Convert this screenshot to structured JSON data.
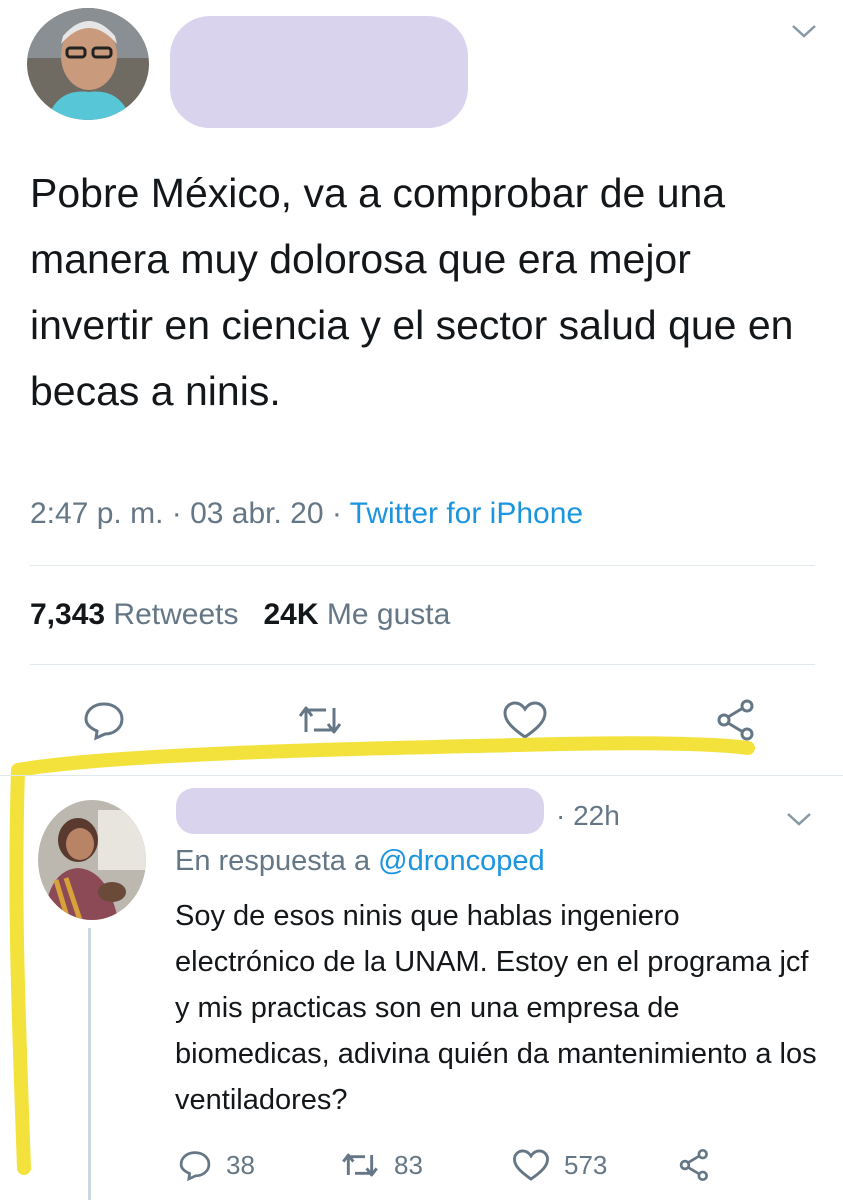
{
  "tweet": {
    "text": "Pobre México, va a comprobar de una manera muy dolorosa que era mejor invertir en ciencia y el sector salud que en becas a ninis.",
    "time": "2:47 p. m.",
    "separator": " · ",
    "date": "03 abr. 20",
    "source": "Twitter for iPhone",
    "retweets_count": "7,343",
    "retweets_label": "Retweets",
    "likes_count": "24K",
    "likes_label": "Me gusta"
  },
  "reply": {
    "time": "· 22h",
    "in_reply_prefix": "En respuesta a ",
    "in_reply_handle": "@droncoped",
    "text": "Soy de esos ninis que hablas ingeniero electrónico de la UNAM. Estoy en el programa jcf y mis practicas son en una empresa de biomedicas, adivina quién da mantenimiento a los ventiladores?",
    "reply_count": "38",
    "retweet_count": "83",
    "like_count": "573"
  },
  "colors": {
    "text": "#14171a",
    "muted": "#657786",
    "link": "#1b95e0",
    "redaction": "#d9d3ee",
    "highlight": "#f4e23c"
  },
  "icons": [
    "reply-icon",
    "retweet-icon",
    "like-icon",
    "share-icon",
    "chevron-down-icon"
  ]
}
